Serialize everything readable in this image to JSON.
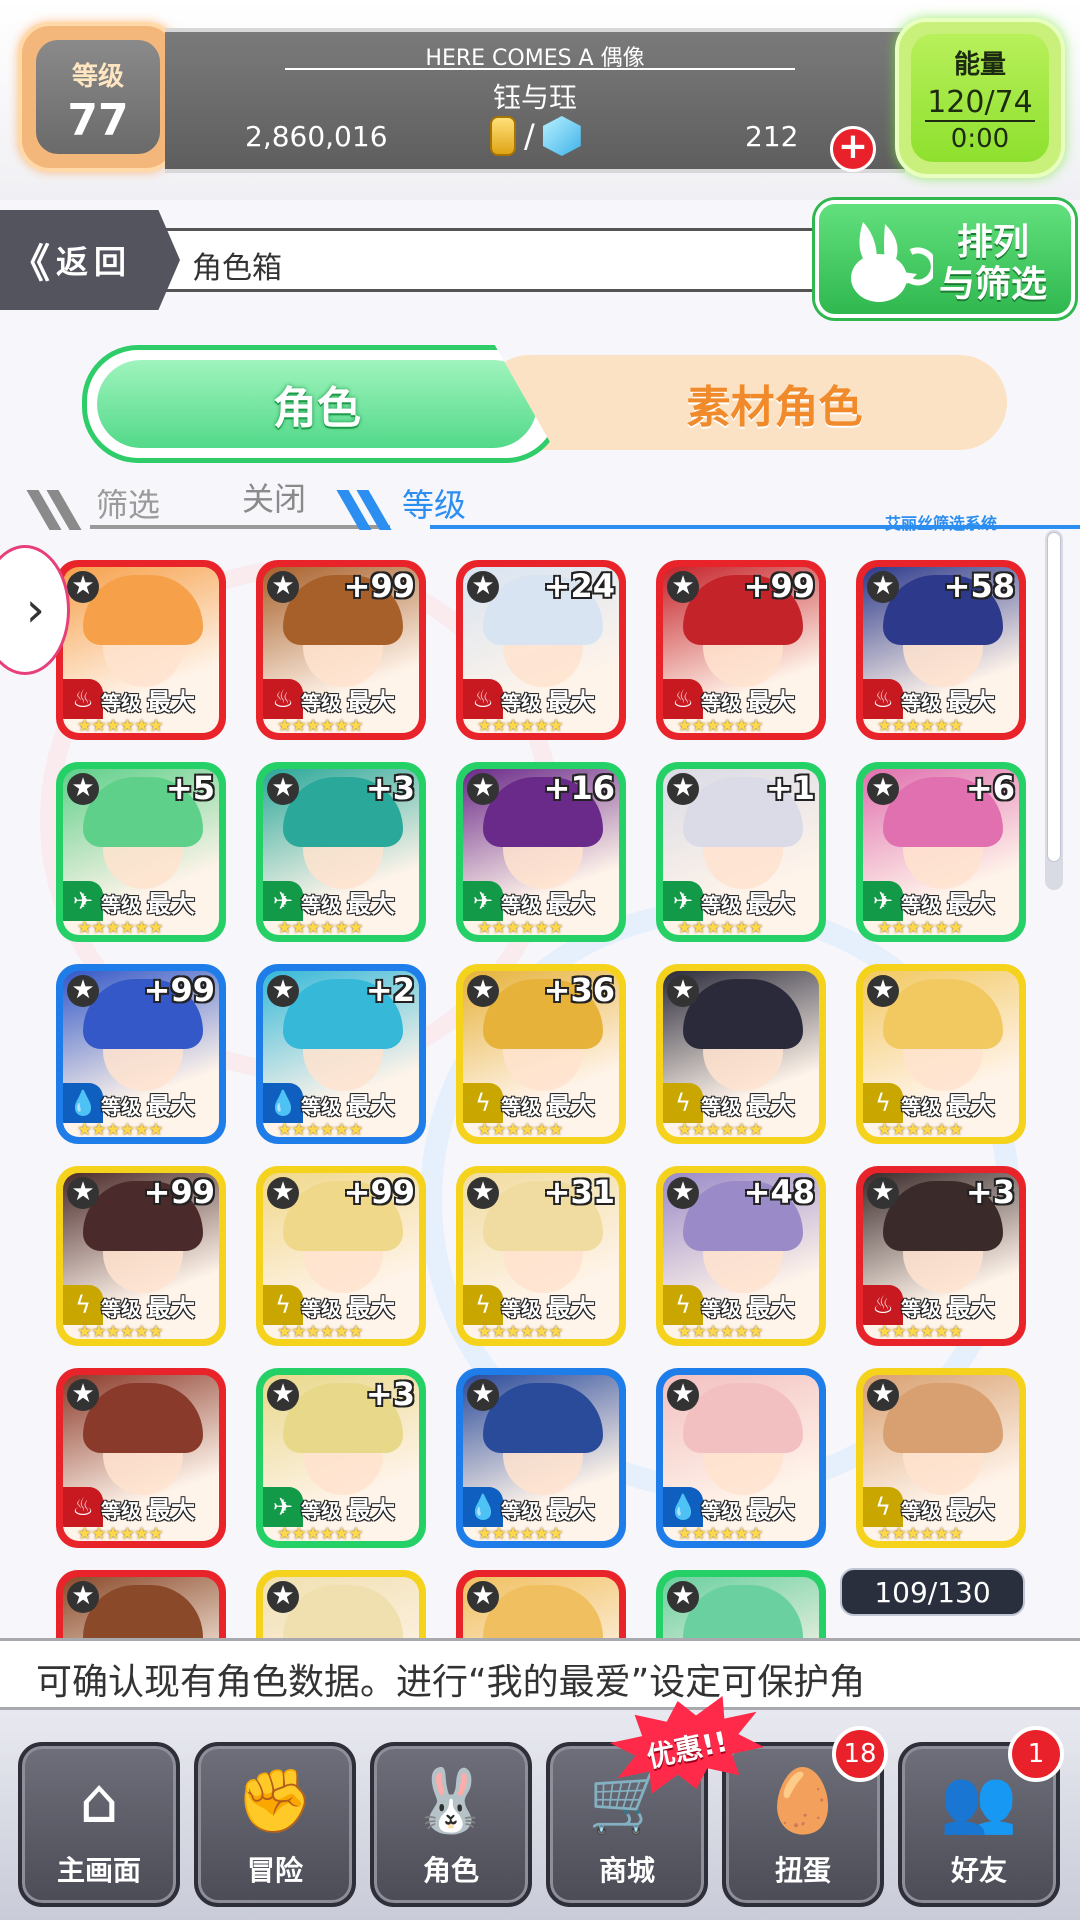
{
  "header": {
    "level_label": "等级",
    "level_value": "77",
    "game_title": "HERE COMES A 偶像",
    "player_name": "钰与珏",
    "coins": "2,860,016",
    "currency_slash": "/",
    "gems": "212",
    "add_label": "+",
    "energy_label": "能量",
    "energy_value": "120/74",
    "energy_timer": "0:00"
  },
  "nav": {
    "back_chevron": "《",
    "back_label": "返回",
    "page_title": "角色箱",
    "sort_label_1": "排列",
    "sort_label_2": "与筛选"
  },
  "tabs": {
    "character": "角色",
    "material": "素材角色"
  },
  "filter": {
    "filter_label": "筛选",
    "close_label": "关闭",
    "level_label": "等级",
    "system_label": "艾丽丝筛选系统"
  },
  "card_common": {
    "star_glyph": "★",
    "level_word": "等级",
    "max_word": "最大",
    "rarity_stars": "★★★★★★"
  },
  "cards": [
    {
      "plus": "",
      "frame": "#e8232a",
      "element": "fire",
      "art": "#f6a04a"
    },
    {
      "plus": "+99",
      "frame": "#e8232a",
      "element": "fire",
      "art": "#a8602a"
    },
    {
      "plus": "+24",
      "frame": "#e8232a",
      "element": "fire",
      "art": "#d8e4f2"
    },
    {
      "plus": "+99",
      "frame": "#e8232a",
      "element": "fire",
      "art": "#c5232a"
    },
    {
      "plus": "+58",
      "frame": "#e8232a",
      "element": "fire",
      "art": "#2d3a8c"
    },
    {
      "plus": "+5",
      "frame": "#25d066",
      "element": "wind",
      "art": "#5ed08a"
    },
    {
      "plus": "+3",
      "frame": "#25d066",
      "element": "wind",
      "art": "#2aa89a"
    },
    {
      "plus": "+16",
      "frame": "#25d066",
      "element": "wind",
      "art": "#6a2a8a"
    },
    {
      "plus": "+1",
      "frame": "#25d066",
      "element": "wind",
      "art": "#dadbe6"
    },
    {
      "plus": "+6",
      "frame": "#25d066",
      "element": "wind",
      "art": "#e070b0"
    },
    {
      "plus": "+99",
      "frame": "#1e7de8",
      "element": "water",
      "art": "#3458c8"
    },
    {
      "plus": "+2",
      "frame": "#1e7de8",
      "element": "water",
      "art": "#36b8d8"
    },
    {
      "plus": "+36",
      "frame": "#f5d21c",
      "element": "thunder",
      "art": "#e6b23a"
    },
    {
      "plus": "",
      "frame": "#f5d21c",
      "element": "thunder",
      "art": "#2a2a3a"
    },
    {
      "plus": "",
      "frame": "#f5d21c",
      "element": "thunder",
      "art": "#f2c860"
    },
    {
      "plus": "+99",
      "frame": "#f5d21c",
      "element": "thunder",
      "art": "#4a2a2a"
    },
    {
      "plus": "+99",
      "frame": "#f5d21c",
      "element": "thunder",
      "art": "#f0d88a"
    },
    {
      "plus": "+31",
      "frame": "#f5d21c",
      "element": "thunder",
      "art": "#f0dca0"
    },
    {
      "plus": "+48",
      "frame": "#f5d21c",
      "element": "thunder",
      "art": "#9a8ac8"
    },
    {
      "plus": "+3",
      "frame": "#e8232a",
      "element": "fire",
      "art": "#3a2a2a"
    },
    {
      "plus": "",
      "frame": "#e8232a",
      "element": "fire",
      "art": "#8a3a2a"
    },
    {
      "plus": "+3",
      "frame": "#25d066",
      "element": "wind",
      "art": "#e8d88a"
    },
    {
      "plus": "",
      "frame": "#1e7de8",
      "element": "water",
      "art": "#2a4a9a"
    },
    {
      "plus": "",
      "frame": "#1e7de8",
      "element": "water",
      "art": "#f2c0c0"
    },
    {
      "plus": "",
      "frame": "#f5d21c",
      "element": "thunder",
      "art": "#d8a070"
    },
    {
      "plus": "",
      "frame": "#e8232a",
      "element": "fire",
      "art": "#8a4a2a"
    },
    {
      "plus": "",
      "frame": "#f5d21c",
      "element": "thunder",
      "art": "#f0e0b0"
    },
    {
      "plus": "",
      "frame": "#e8232a",
      "element": "fire",
      "art": "#f0c060"
    },
    {
      "plus": "",
      "frame": "#25d066",
      "element": "wind",
      "art": "#6ad0a0"
    }
  ],
  "element_icons": {
    "fire": {
      "glyph": "♨",
      "color": "#c81820"
    },
    "wind": {
      "glyph": "✈",
      "color": "#139a48"
    },
    "water": {
      "glyph": "💧",
      "color": "#0e5fbf"
    },
    "thunder": {
      "glyph": "ϟ",
      "color": "#c9a600"
    }
  },
  "box_count": "109/130",
  "marquee_text": "可确认现有角色数据。进行“我的最爱”设定可保护角",
  "bottom_nav": [
    {
      "label": "主画面",
      "icon": "⌂",
      "badge": ""
    },
    {
      "label": "冒险",
      "icon": "✊",
      "badge": ""
    },
    {
      "label": "角色",
      "icon": "🐰",
      "badge": ""
    },
    {
      "label": "商城",
      "icon": "🛒",
      "badge": ""
    },
    {
      "label": "扭蛋",
      "icon": "🥚",
      "badge": "18"
    },
    {
      "label": "好友",
      "icon": "👥",
      "badge": "1"
    }
  ],
  "sale_tag": "优惠!!",
  "colors": {
    "accent_green": "#2fcc6a",
    "accent_orange": "#f08a2a",
    "accent_blue": "#2b8ef0",
    "badge_red": "#e8212a"
  }
}
